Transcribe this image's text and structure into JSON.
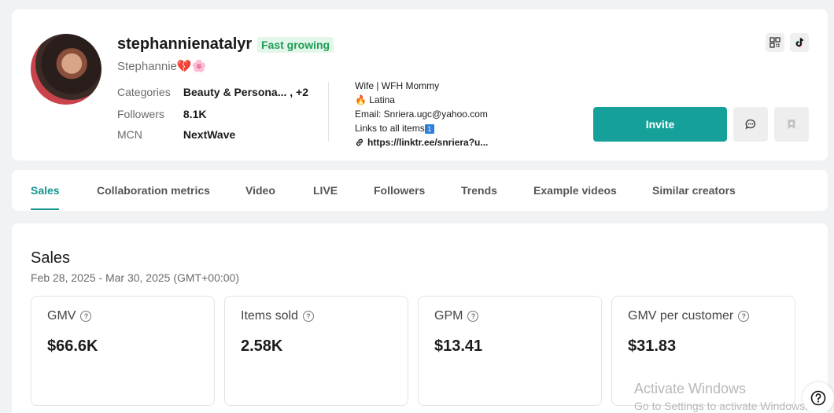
{
  "profile": {
    "username": "stephannienatalyr",
    "badge": "Fast growing",
    "display_name": "Stephannie💔🌸",
    "categories_label": "Categories",
    "categories_value": "Beauty & Persona... , +2",
    "followers_label": "Followers",
    "followers_value": "8.1K",
    "mcn_label": "MCN",
    "mcn_value": "NextWave",
    "bio": {
      "line1": "Wife | WFH Mommy",
      "line2": "🔥 Latina",
      "line3": "Email: Snriera.ugc@yahoo.com",
      "line4": "Links to all items",
      "line4_emoji": "1",
      "link": "https://linktr.ee/snriera?u..."
    },
    "invite_label": "Invite",
    "icons": {
      "qr": "qr-code-icon",
      "tiktok": "tiktok-icon",
      "message": "message-icon",
      "bookmark": "bookmark-icon"
    }
  },
  "tabs": [
    {
      "label": "Sales",
      "active": true
    },
    {
      "label": "Collaboration metrics"
    },
    {
      "label": "Video"
    },
    {
      "label": "LIVE"
    },
    {
      "label": "Followers"
    },
    {
      "label": "Trends"
    },
    {
      "label": "Example videos"
    },
    {
      "label": "Similar creators"
    }
  ],
  "sales": {
    "title": "Sales",
    "range": "Feb 28, 2025 - Mar 30, 2025 (GMT+00:00)",
    "metrics": [
      {
        "label": "GMV",
        "value": "$66.6K"
      },
      {
        "label": "Items sold",
        "value": "2.58K"
      },
      {
        "label": "GPM",
        "value": "$13.41"
      },
      {
        "label": "GMV per customer",
        "value": "$31.83"
      }
    ]
  },
  "watermark": {
    "title": "Activate Windows",
    "subtitle": "Go to Settings to activate Windows."
  },
  "help_symbol": "?",
  "colors": {
    "accent": "#16a09a",
    "badge_bg": "#e3f6ea",
    "badge_text": "#1f9d55"
  }
}
